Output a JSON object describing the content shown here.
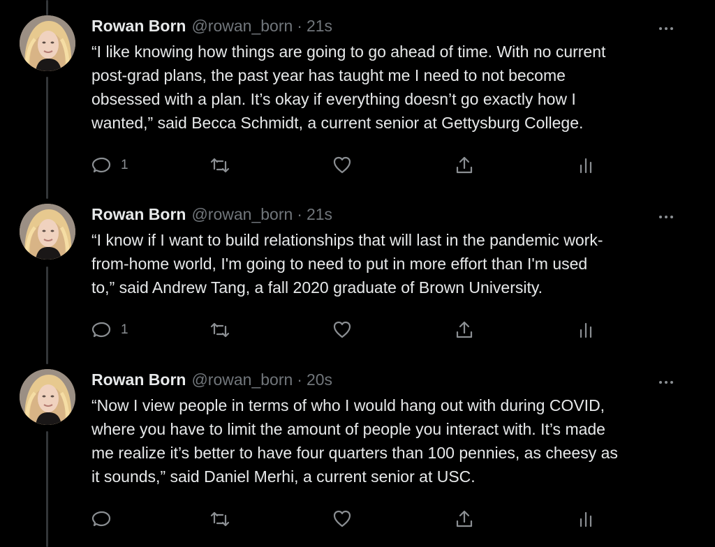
{
  "colors": {
    "background": "#000000",
    "text": "#e7e9ea",
    "secondary_text": "#71767b",
    "icon": "#8b8f93",
    "thread_line": "#333639"
  },
  "tweets": [
    {
      "display_name": "Rowan Born",
      "handle": "@rowan_born",
      "separator": "·",
      "time": "21s",
      "text": "“I like knowing how things are going to go ahead of time. With no current\npost-grad plans, the past year has taught me I need to not become\nobsessed with a plan. It’s okay if everything doesn’t go exactly how I\nwanted,” said Becca Schmidt, a current senior at Gettysburg College.",
      "reply_count": "1",
      "retweet_count": "",
      "like_count": "",
      "icons": {
        "more": "more-horizontal-icon",
        "reply": "reply-icon",
        "retweet": "retweet-icon",
        "like": "heart-icon",
        "share": "share-icon",
        "analytics": "analytics-icon"
      }
    },
    {
      "display_name": "Rowan Born",
      "handle": "@rowan_born",
      "separator": "·",
      "time": "21s",
      "text": "“I know if I want to build relationships that will last in the pandemic work-\nfrom-home world, I'm going to need to put in more effort than I'm used\nto,” said Andrew Tang, a fall 2020 graduate of Brown University.",
      "reply_count": "1",
      "retweet_count": "",
      "like_count": "",
      "icons": {
        "more": "more-horizontal-icon",
        "reply": "reply-icon",
        "retweet": "retweet-icon",
        "like": "heart-icon",
        "share": "share-icon",
        "analytics": "analytics-icon"
      }
    },
    {
      "display_name": "Rowan Born",
      "handle": "@rowan_born",
      "separator": "·",
      "time": "20s",
      "text": "“Now I view people in terms of who I would hang out with during COVID,\nwhere you have to limit the amount of people you interact with. It’s made\nme realize it’s better to have four quarters than 100 pennies, as cheesy as\nit sounds,” said Daniel Merhi, a current senior at USC.",
      "reply_count": "",
      "retweet_count": "",
      "like_count": "",
      "icons": {
        "more": "more-horizontal-icon",
        "reply": "reply-icon",
        "retweet": "retweet-icon",
        "like": "heart-icon",
        "share": "share-icon",
        "analytics": "analytics-icon"
      }
    }
  ]
}
